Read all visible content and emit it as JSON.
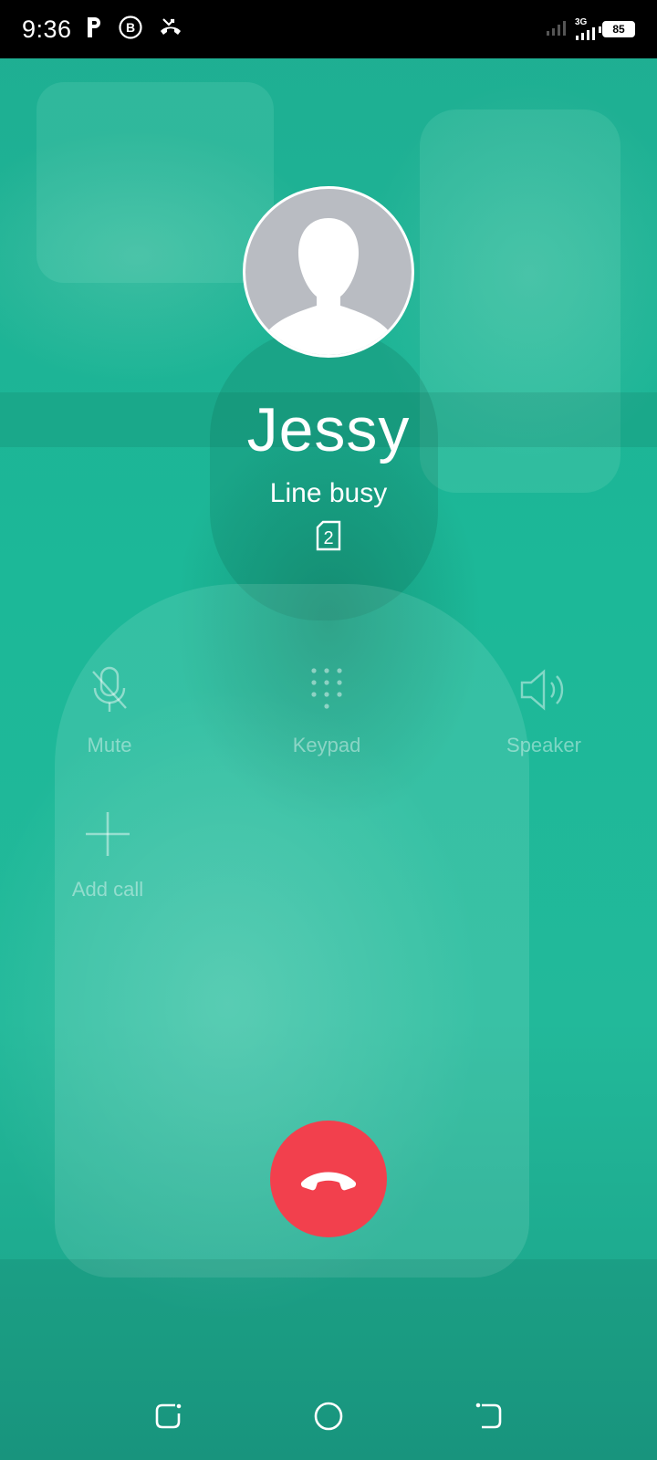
{
  "status_bar": {
    "time": "9:36",
    "icons_left": [
      "p-icon",
      "b-icon",
      "missed-call-icon"
    ],
    "network": "3G",
    "battery": "85"
  },
  "contact": {
    "name": "Jessy",
    "status": "Line busy",
    "sim": "2"
  },
  "controls": {
    "mute": "Mute",
    "keypad": "Keypad",
    "speaker": "Speaker",
    "add_call": "Add call"
  },
  "colors": {
    "background": "#1db99a",
    "end_call": "#f2404d",
    "avatar": "#b9bcc2"
  }
}
